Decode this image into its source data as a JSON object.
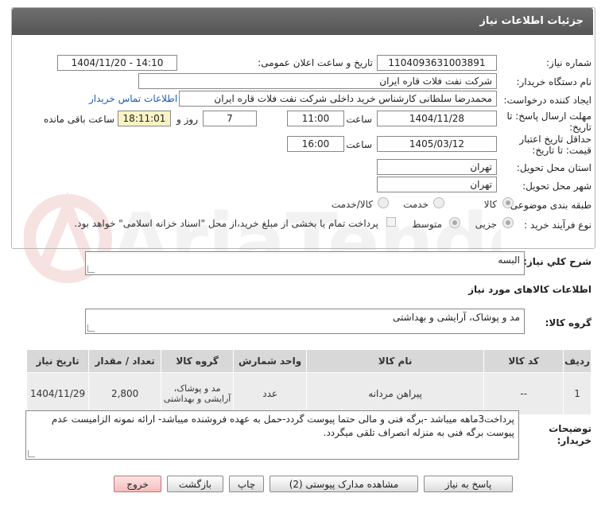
{
  "header": {
    "title": "جزئیات اطلاعات نیاز"
  },
  "watermark": {
    "text": "AriaTender.net"
  },
  "fields": {
    "need_number_label": "شماره نیاز:",
    "need_number": "1104093631003891",
    "announce_label": "تاریخ و ساعت اعلان عمومی:",
    "announce_value": "1404/11/20 - 14:10",
    "buyer_label": "نام دستگاه خریدار:",
    "buyer_value": "شرکت نفت فلات قاره ایران",
    "creator_label": "ایجاد کننده درخواست:",
    "creator_value": "محمدرضا سلطانی کارشناس خرید داخلی شرکت نفت فلات قاره ایران",
    "contact_link": "اطلاعات تماس خریدار",
    "deadline_label_1": "مهلت ارسال پاسخ: تا",
    "deadline_label_2": "تاریخ:",
    "deadline_date": "1404/11/28",
    "time_label": "ساعت",
    "deadline_time": "11:00",
    "days_value": "7",
    "days_label": "روز و",
    "remaining_time": "18:11:01",
    "remaining_label": "ساعت باقی مانده",
    "validity_label_1": "حداقل تاریخ اعتبار",
    "validity_label_2": "قیمت: تا تاریخ:",
    "validity_date": "1405/03/12",
    "validity_time_label": "ساعت",
    "validity_time": "16:00",
    "province_label": "استان محل تحویل:",
    "province_value": "تهران",
    "city_label": "شهر محل تحویل:",
    "city_value": "تهران",
    "category_label": "طبقه بندی موضوعی:",
    "category_options": [
      "کالا",
      "خدمت",
      "کالا/خدمت"
    ],
    "process_label": "نوع فرآیند خرید :",
    "process_options": [
      "جزیی",
      "متوسط"
    ],
    "payment_note": "پرداخت تمام یا بخشی از مبلغ خرید،از محل \"اسناد خزانه اسلامی\" خواهد بود."
  },
  "summary": {
    "label": "شرح کلي نياز:",
    "value": "البسه"
  },
  "goods_section": {
    "title": "اطلاعات کالاهای مورد نیاز",
    "group_label": "گروه کالا:",
    "group_value": "مد و پوشاک، آرایشی و بهداشتی"
  },
  "table": {
    "headers": [
      "ردیف",
      "کد کالا",
      "نام کالا",
      "واحد شمارش",
      "گروه کالا",
      "تعداد / مقدار",
      "تاریخ نیاز"
    ],
    "rows": [
      [
        "1",
        "--",
        "پیراهن مردانه",
        "عدد",
        "مد و پوشاک، آرایشی و بهداشتی",
        "2,800",
        "1404/11/29"
      ]
    ]
  },
  "notes": {
    "label_1": "توضیحات",
    "label_2": "خریدار:",
    "value": "پرداخت3ماهه میباشد -برگه فنی و مالی حتما پیوست گردد-حمل به عهده فروشنده میباشد- ارائه نمونه الزامیست عدم پیوست برگه فنی به منزله انصراف تلقی میگردد."
  },
  "buttons": {
    "reply": "پاسخ به نیاز",
    "attachments": "مشاهده مدارک پیوستی (2)",
    "print": "چاپ",
    "back": "بازگشت",
    "exit": "خروج"
  },
  "colors": {
    "header_bg": "#5f5f5f",
    "link": "#1a5fb4",
    "remaining_bg": "#fbf3c5",
    "exit_bg": "#f4c4c4"
  }
}
